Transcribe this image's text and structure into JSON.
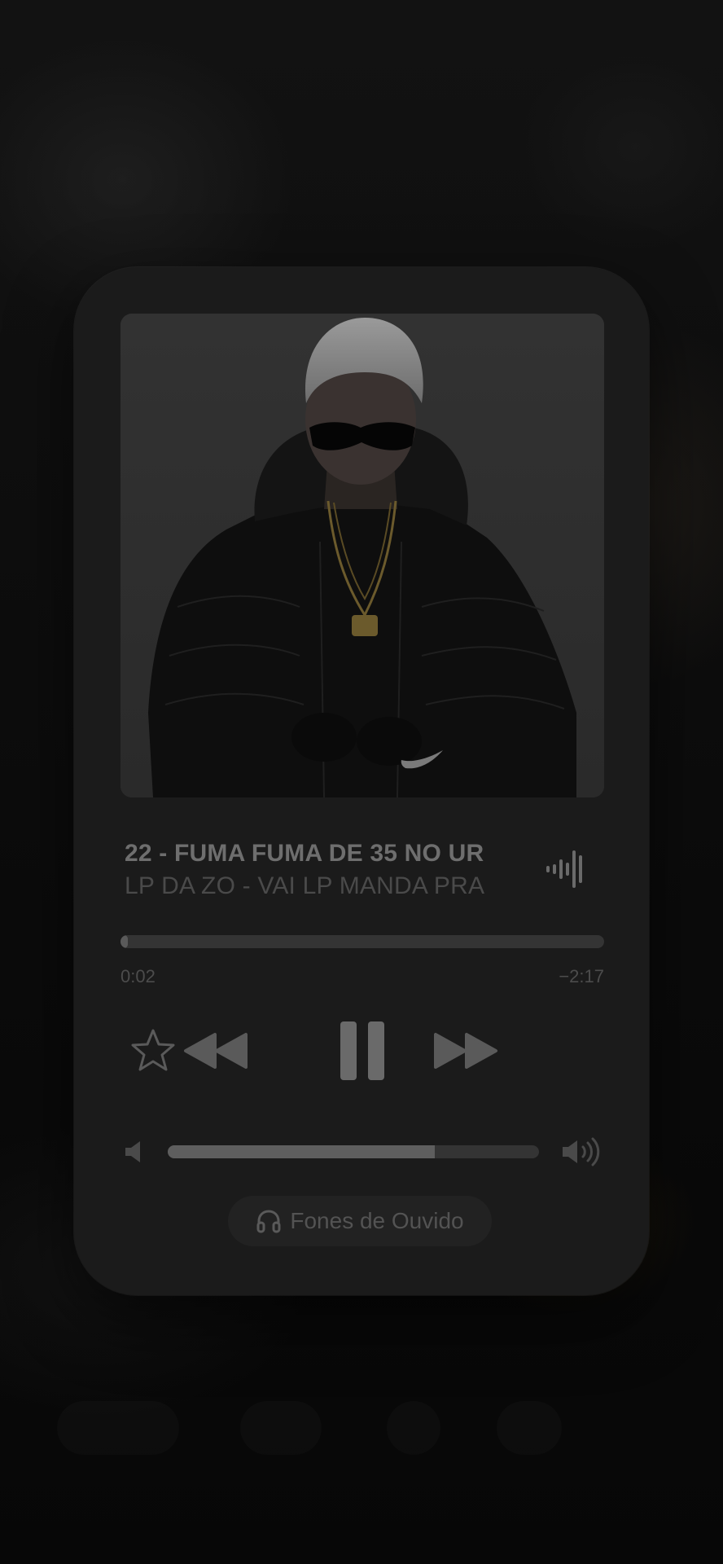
{
  "now_playing": {
    "title": "22 - FUMA FUMA DE 35 NO UR",
    "artist": "LP DA ZO - VAI LP MANDA PRA",
    "elapsed": "0:02",
    "remaining": "−2:17",
    "progress_fraction": 0.015,
    "volume_fraction": 0.72
  },
  "controls": {
    "favorite_icon": "star-outline-icon",
    "previous_icon": "rewind-icon",
    "play_pause_icon": "pause-icon",
    "next_icon": "fast-forward-icon",
    "waveform_icon": "audio-waveform-icon",
    "volume_low_icon": "speaker-low-icon",
    "volume_high_icon": "speaker-high-icon"
  },
  "output_route": {
    "label": "Fones de Ouvido",
    "icon": "headphones-icon"
  },
  "colors": {
    "card_background": "#1b1b1b",
    "accent_dim": "#5a5a5a"
  }
}
